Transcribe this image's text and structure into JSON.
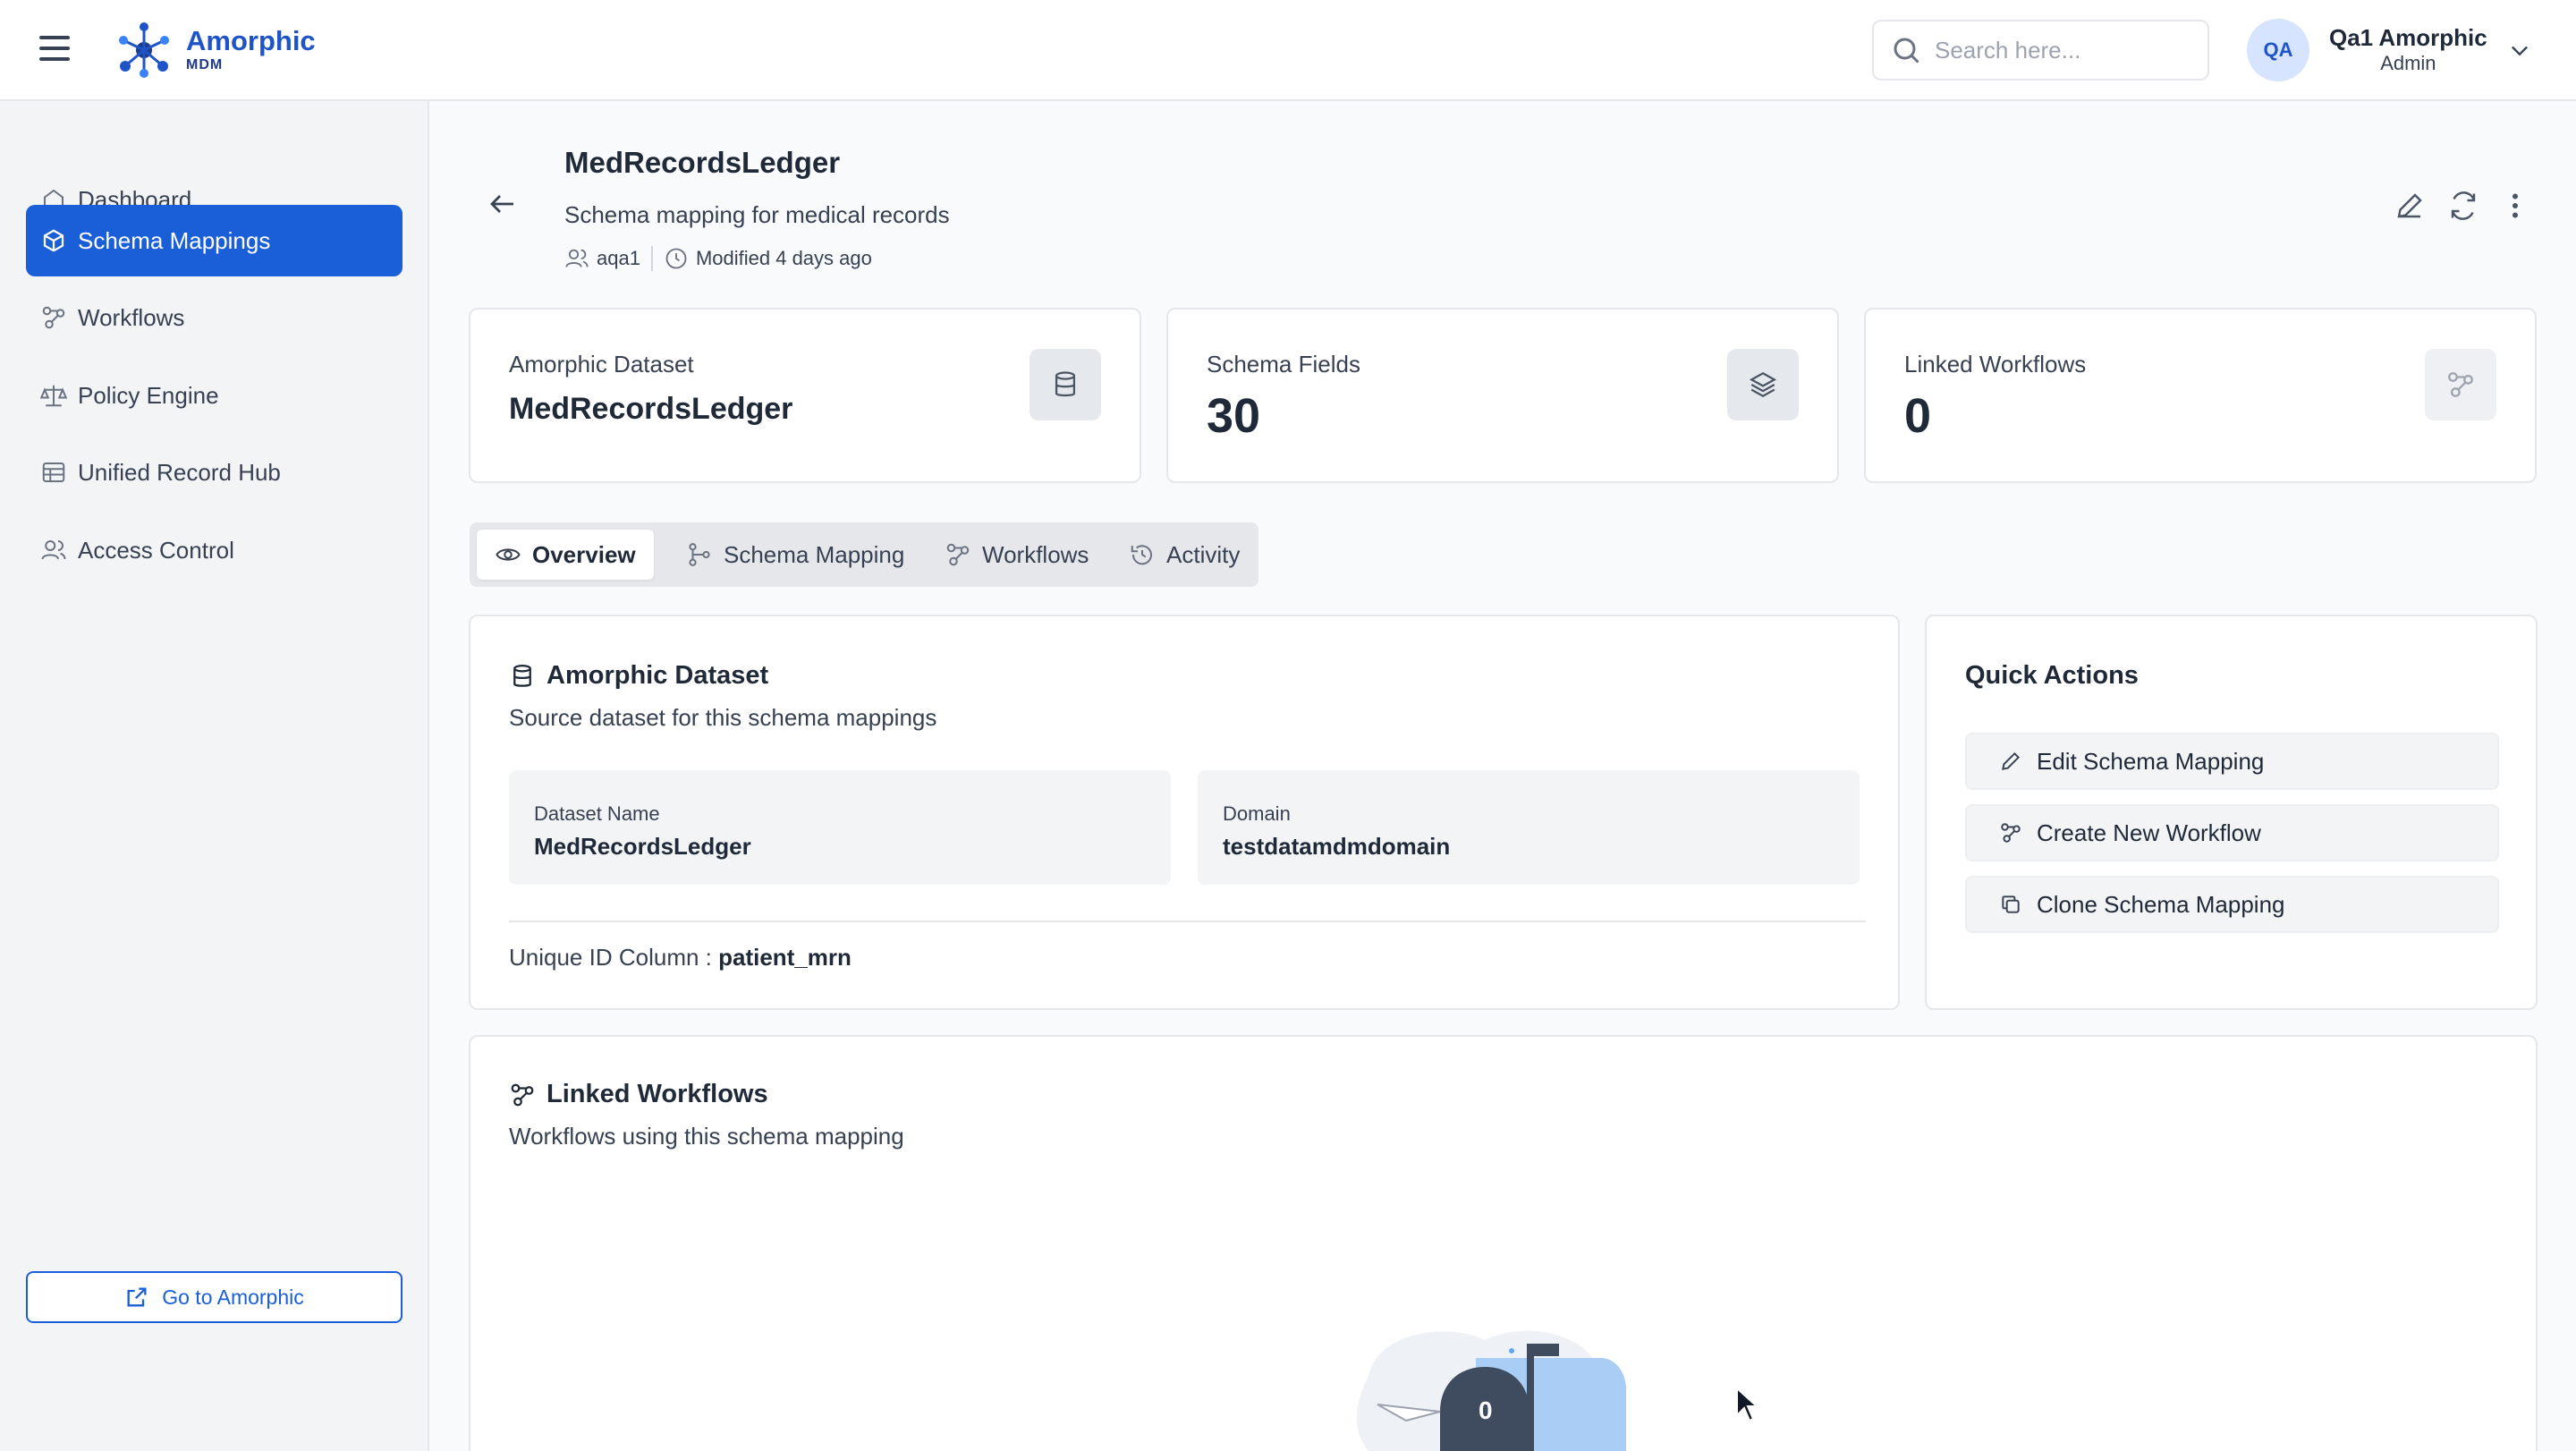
{
  "app": {
    "name": "Amorphic",
    "sub": "MDM"
  },
  "header": {
    "search_placeholder": "Search here...",
    "user": {
      "initials": "QA",
      "name": "Qa1 Amorphic",
      "role": "Admin"
    }
  },
  "sidebar": {
    "items": [
      {
        "label": "Dashboard",
        "icon": "home-icon"
      },
      {
        "label": "Schema Mappings",
        "icon": "cube-icon",
        "active": true
      },
      {
        "label": "Workflows",
        "icon": "workflow-icon"
      },
      {
        "label": "Policy Engine",
        "icon": "scale-icon"
      },
      {
        "label": "Unified Record Hub",
        "icon": "table-icon"
      },
      {
        "label": "Access Control",
        "icon": "users-icon"
      }
    ],
    "goto_label": "Go to Amorphic"
  },
  "page": {
    "title": "MedRecordsLedger",
    "description": "Schema mapping for medical records",
    "owner": "aqa1",
    "modified": "Modified 4 days ago"
  },
  "stats": [
    {
      "label": "Amorphic Dataset",
      "value": "MedRecordsLedger",
      "icon": "database-icon"
    },
    {
      "label": "Schema Fields",
      "value": "30",
      "icon": "layers-icon"
    },
    {
      "label": "Linked Workflows",
      "value": "0",
      "icon": "workflow-icon"
    }
  ],
  "tabs": [
    {
      "label": "Overview",
      "icon": "eye-icon",
      "active": true
    },
    {
      "label": "Schema Mapping",
      "icon": "git-branch-icon"
    },
    {
      "label": "Workflows",
      "icon": "workflow-icon"
    },
    {
      "label": "Activity",
      "icon": "history-icon"
    }
  ],
  "dataset_panel": {
    "title": "Amorphic Dataset",
    "subtitle": "Source dataset for this schema mappings",
    "dataset_name_label": "Dataset Name",
    "dataset_name": "MedRecordsLedger",
    "domain_label": "Domain",
    "domain": "testdatamdmdomain",
    "unique_id_label": "Unique ID Column :",
    "unique_id": "patient_mrn"
  },
  "quick_actions": {
    "title": "Quick Actions",
    "items": [
      {
        "label": "Edit Schema Mapping",
        "icon": "pencil-icon"
      },
      {
        "label": "Create New Workflow",
        "icon": "workflow-icon"
      },
      {
        "label": "Clone Schema Mapping",
        "icon": "copy-icon"
      }
    ]
  },
  "linked_panel": {
    "title": "Linked Workflows",
    "subtitle": "Workflows using this schema mapping",
    "empty_count": "0"
  },
  "colors": {
    "primary": "#1a5fd8",
    "brand": "#1e54c8",
    "sidebar_bg": "#f3f4f6"
  }
}
